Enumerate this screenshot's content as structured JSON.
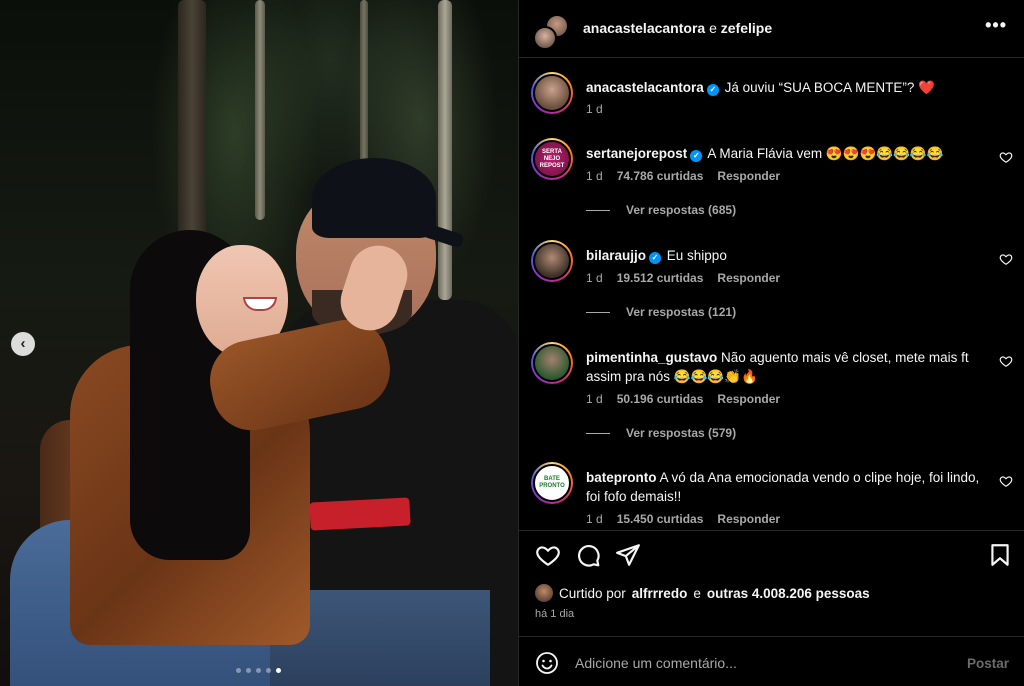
{
  "post": {
    "header": {
      "user1": "anacastelacantora",
      "conjunction": "e",
      "user2": "zefelipe",
      "more_icon": "more-horizontal-icon"
    },
    "caption": {
      "username": "anacastelacantora",
      "verified": true,
      "text": "Já ouviu “SUA BOCA MENTE”? ❤️",
      "time": "1 d"
    },
    "carousel": {
      "prev_icon": "chevron-left-icon",
      "total_slides": 5,
      "active_slide": 5
    }
  },
  "comments": [
    {
      "username": "sertanejorepost",
      "verified": true,
      "text": "A Maria Flávia vem 😍😍😍😂😂😂😂",
      "time": "1 d",
      "likes": "74.786 curtidas",
      "reply_label": "Responder",
      "view_replies": "Ver respostas (685)",
      "avatar_text": "SERTA NEJO REPOST"
    },
    {
      "username": "bilaraujjo",
      "verified": true,
      "text": "Eu shippo",
      "time": "1 d",
      "likes": "19.512 curtidas",
      "reply_label": "Responder",
      "view_replies": "Ver respostas (121)"
    },
    {
      "username": "pimentinha_gustavo",
      "verified": false,
      "text": "Não aguento mais vê closet, mete mais ft assim pra nós 😂😂😂👏🔥",
      "time": "1 d",
      "likes": "50.196 curtidas",
      "reply_label": "Responder",
      "view_replies": "Ver respostas (579)"
    },
    {
      "username": "batepronto",
      "verified": false,
      "text": "A vó da Ana emocionada vendo o clipe hoje, foi lindo, foi fofo demais!!",
      "time": "1 d",
      "likes": "15.450 curtidas",
      "reply_label": "Responder",
      "avatar_text": "BATE PRONTO"
    }
  ],
  "likes": {
    "prefix": "Curtido por",
    "user": "alfrrredo",
    "conjunction": "e",
    "others": "outras 4.008.206 pessoas",
    "time": "há 1 dia"
  },
  "add_comment": {
    "placeholder": "Adicione um comentário...",
    "post_label": "Postar"
  },
  "icons": {
    "like": "heart-icon",
    "comment": "comment-icon",
    "share": "send-icon",
    "save": "bookmark-icon",
    "emoji": "emoji-icon"
  },
  "colors": {
    "background": "#000000",
    "text": "#f5f5f5",
    "muted": "#a8a8a8",
    "verified": "#0095f6",
    "divider": "#262626"
  }
}
